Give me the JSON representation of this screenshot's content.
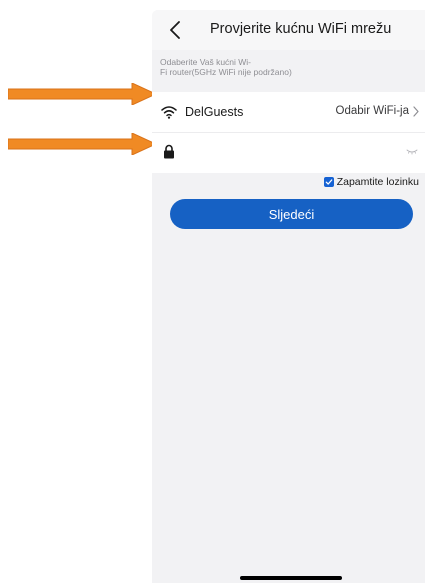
{
  "header": {
    "title": "Provjerite kućnu WiFi mrežu",
    "back_icon": "chevron-left-icon"
  },
  "hint": {
    "line1": "Odaberite Vaš kućni Wi-",
    "line2": "Fi router(5GHz WiFi nije podržano)"
  },
  "wifi_row": {
    "ssid": "DelGuests",
    "choose_label": "Odabir WiFi-ja",
    "icon": "wifi-icon",
    "chevron": "chevron-right-icon"
  },
  "password_row": {
    "value": "",
    "placeholder": "",
    "icon": "lock-icon",
    "toggle_icon": "eye-closed-icon"
  },
  "remember": {
    "label": "Zapamtite lozinku",
    "checked": true
  },
  "next_button": {
    "label": "Sljedeći"
  },
  "colors": {
    "accent": "#1661c4",
    "annotation_arrow": "#f08a24"
  }
}
